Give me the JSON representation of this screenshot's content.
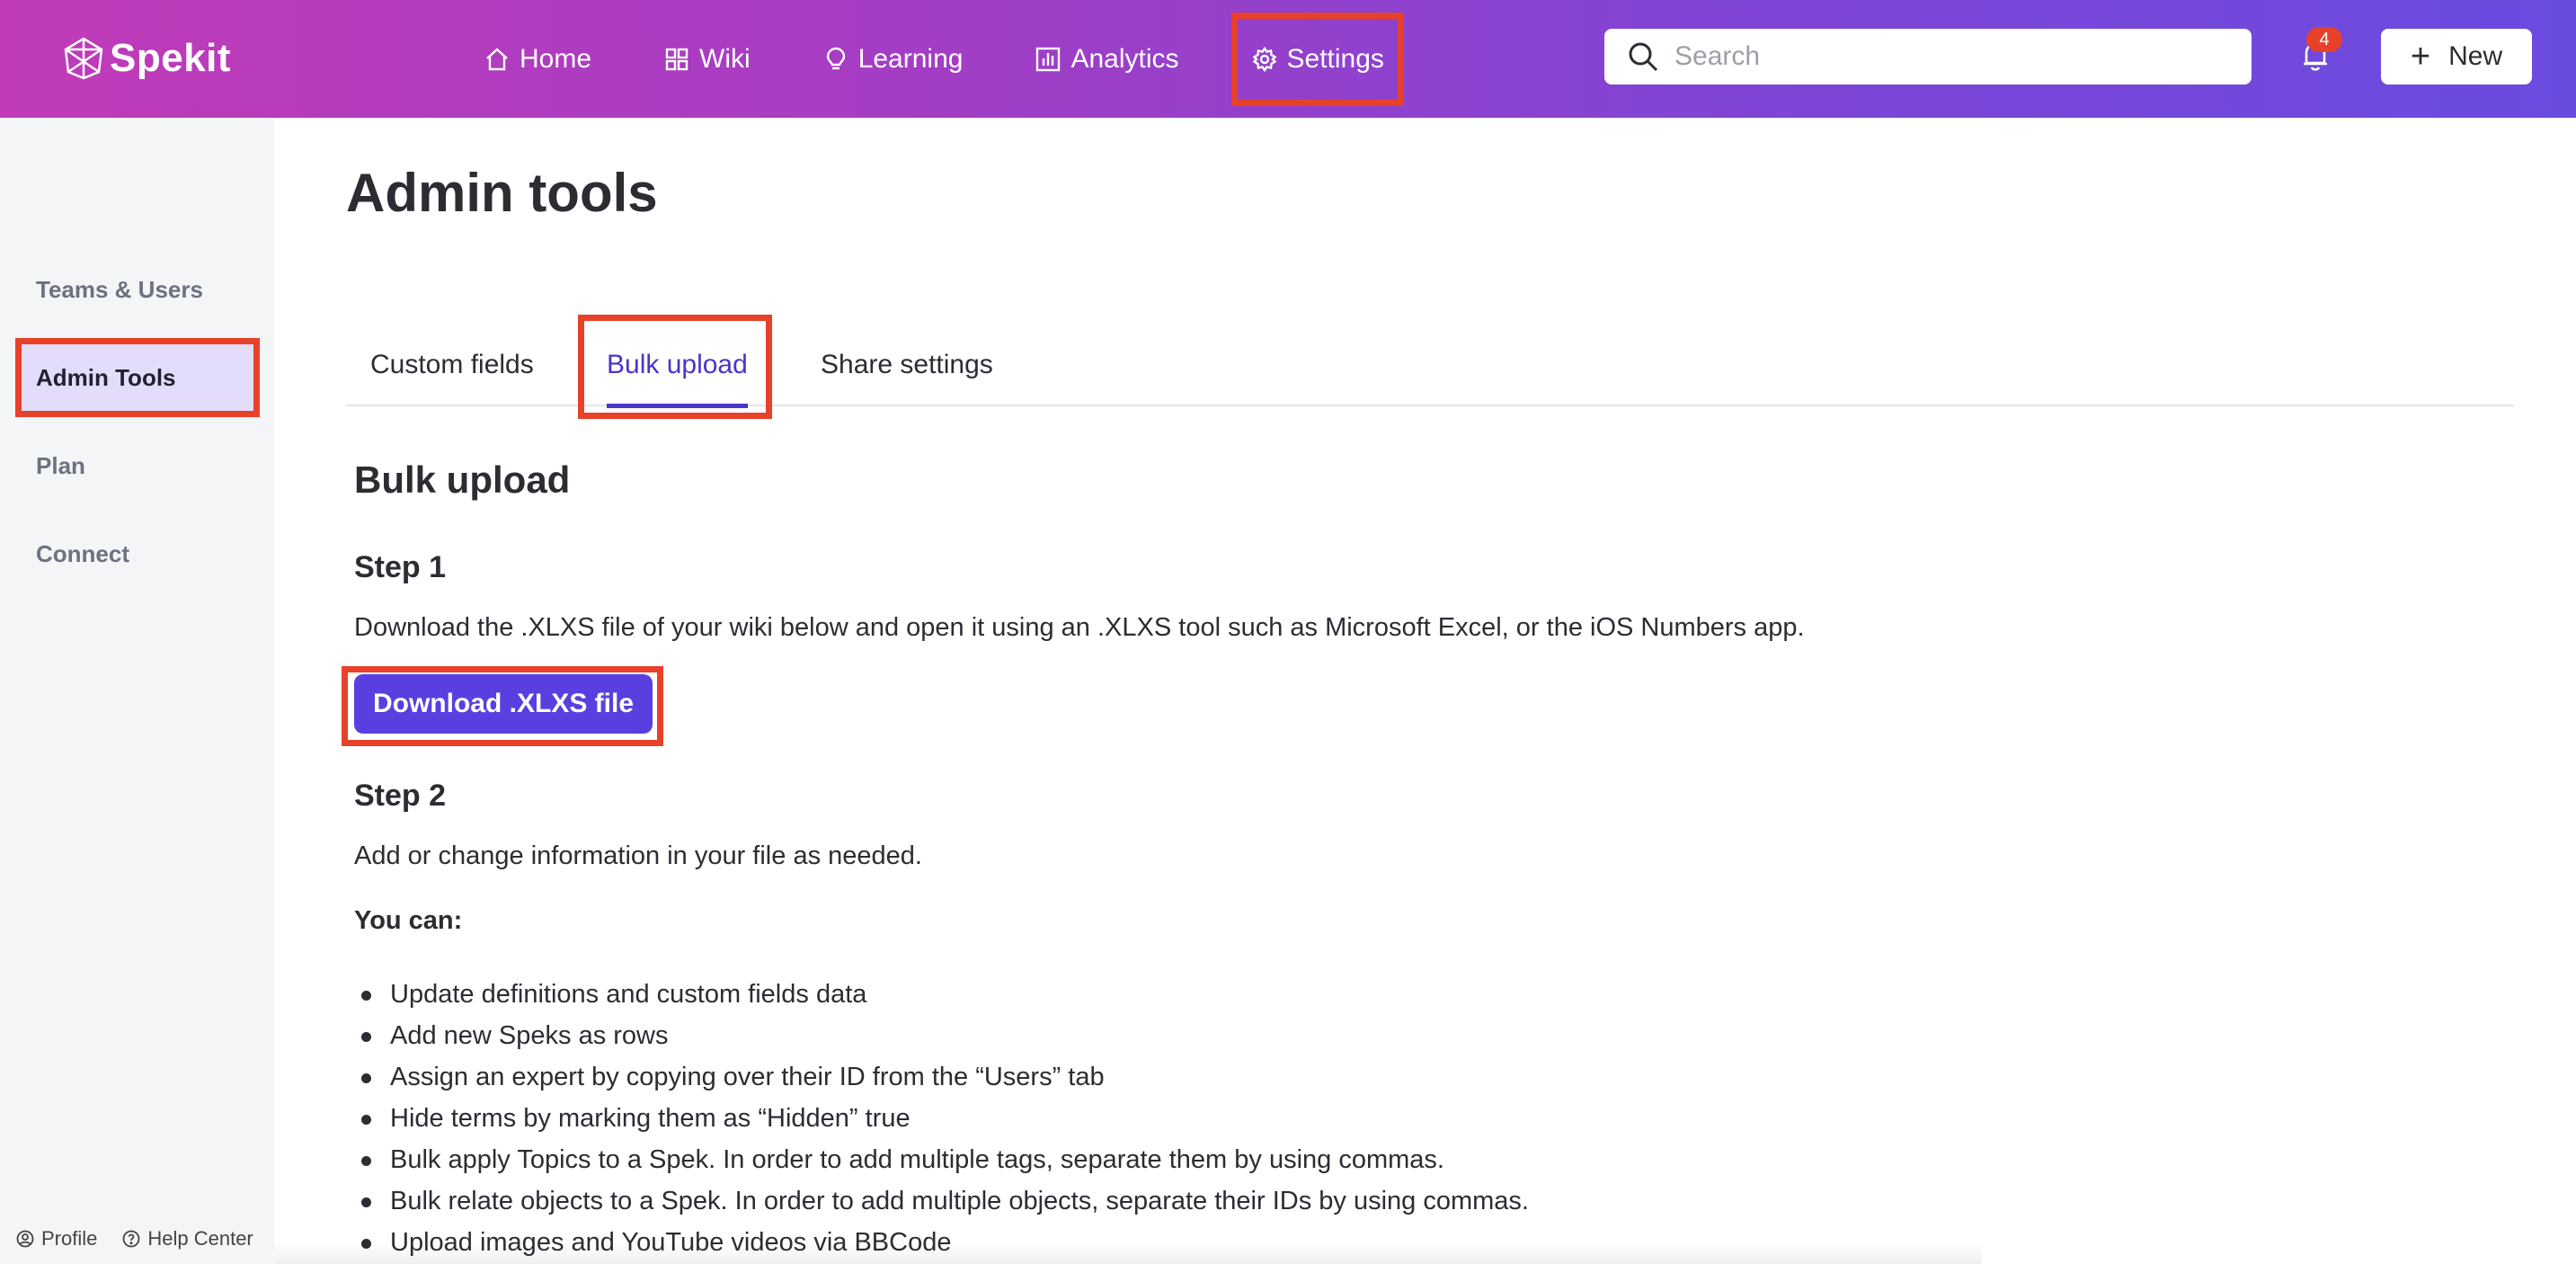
{
  "header": {
    "brand": "Spekit",
    "nav": [
      {
        "label": "Home",
        "icon": "home-icon"
      },
      {
        "label": "Wiki",
        "icon": "grid-icon"
      },
      {
        "label": "Learning",
        "icon": "lightbulb-icon"
      },
      {
        "label": "Analytics",
        "icon": "bar-chart-icon"
      },
      {
        "label": "Settings",
        "icon": "gear-icon"
      }
    ],
    "search": {
      "placeholder": "Search",
      "value": ""
    },
    "notifications_count": "4",
    "new_label": "New"
  },
  "sidebar": {
    "items": [
      {
        "label": "Teams & Users"
      },
      {
        "label": "Admin Tools"
      },
      {
        "label": "Plan"
      },
      {
        "label": "Connect"
      }
    ],
    "active_item": "Admin Tools",
    "footer": {
      "profile": "Profile",
      "help": "Help Center"
    }
  },
  "main": {
    "title": "Admin tools",
    "tabs": [
      {
        "label": "Custom fields"
      },
      {
        "label": "Bulk upload"
      },
      {
        "label": "Share settings"
      }
    ],
    "active_tab": "Bulk upload",
    "section_title": "Bulk upload",
    "step1": {
      "title": "Step 1",
      "text": "Download the .XLXS file of your wiki below and open it using an .XLXS tool such as Microsoft Excel, or the iOS Numbers app.",
      "button": "Download .XLXS file"
    },
    "step2": {
      "title": "Step 2",
      "text": "Add or change information in your file as needed.",
      "you_can": "You can:",
      "bullets": [
        "Update definitions and custom fields data",
        "Add new Speks as rows",
        "Assign an expert by copying over their ID from the “Users” tab",
        "Hide terms by marking them as “Hidden” true",
        "Bulk apply Topics to a Spek. In order to add multiple tags, separate them by using commas.",
        "Bulk relate objects to a Spek. In order to add multiple objects, separate their IDs by using commas.",
        "Upload images and YouTube videos via BBCode"
      ]
    }
  },
  "colors": {
    "accent": "#5a3fe0",
    "highlight": "#e8412a",
    "active_tab": "#4b34c9",
    "sidebar_active_bg": "#e3dcfb"
  }
}
